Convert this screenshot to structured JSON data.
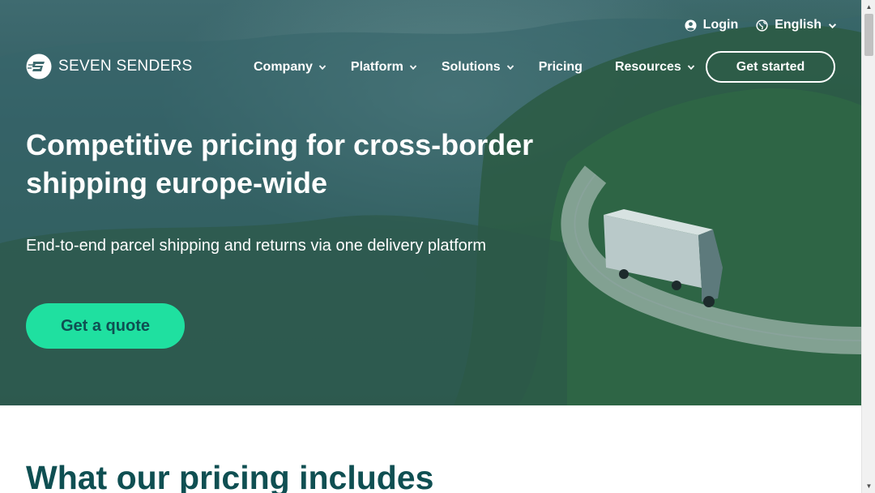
{
  "header": {
    "login_label": "Login",
    "language_label": "English",
    "logo_text": "SEVEN SENDERS",
    "cta_label": "Get started"
  },
  "nav": {
    "items": [
      {
        "label": "Company",
        "has_dropdown": true
      },
      {
        "label": "Platform",
        "has_dropdown": true
      },
      {
        "label": "Solutions",
        "has_dropdown": true
      },
      {
        "label": "Pricing",
        "has_dropdown": false
      },
      {
        "label": "Resources",
        "has_dropdown": true
      }
    ]
  },
  "hero": {
    "headline_line1": "Competitive pricing for cross-border",
    "headline_line2": "shipping europe-wide",
    "subline": "End-to-end parcel shipping and returns via one delivery platform",
    "cta_label": "Get a quote"
  },
  "section": {
    "title": "What our pricing includes"
  },
  "icons": {
    "login": "user-circle-icon",
    "language": "globe-icon",
    "dropdown": "chevron-down-icon"
  },
  "colors": {
    "accent": "#1fe0a0",
    "brand_dark": "#0f4f52",
    "hero_overlay": "#2e5a55",
    "white": "#ffffff"
  }
}
